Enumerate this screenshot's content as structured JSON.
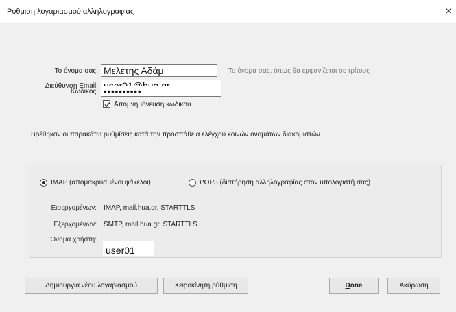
{
  "window": {
    "title": "Ρύθμιση λογαριασμού αλληλογραφίας",
    "close_label": "×"
  },
  "form": {
    "name_label": "Το όνομα σας:",
    "name_value": "Μελέτης Αδάμ",
    "name_hint": "Το όνομα σας, όπως θα εμφανίζεται σε τρίτους",
    "email_label": "Διεύθυνση Email:",
    "email_value": "user01@hua.gr",
    "password_label": "Κωδικός:",
    "password_value": "••••••••••",
    "remember_password_label": "Απομνημόνευση κωδικού",
    "remember_password_checked": true
  },
  "found_message": "Βρέθηκαν οι παρακάτω ρυθμίσεις κατά την προσπάθεια ελέγχου κοινών ονομάτων διακομιστών",
  "protocol": {
    "imap_label": "IMAP (απομακρυσμένοι φάκελοι)",
    "pop3_label": "POP3 (διατήρηση αλληλογραφίας στον υπολογιστή σας)",
    "selected": "IMAP"
  },
  "servers": {
    "incoming_label": "Εισερχομένων:",
    "incoming_value": "IMAP, mail.hua.gr, STARTTLS",
    "outgoing_label": "Εξερχομένων:",
    "outgoing_value": "SMTP, mail.hua.gr, STARTTLS",
    "username_label": "Όνομα χρήστη:",
    "username_value": "user01"
  },
  "buttons": {
    "new_account": "Δημιουργία νέου λογαριασμού",
    "manual_config": "Χειροκίνητη ρύθμιση",
    "done_first": "D",
    "done_rest": "one",
    "cancel": "Ακύρωση"
  },
  "icons": {
    "close": "close-icon",
    "checkmark": "checkmark-icon"
  }
}
